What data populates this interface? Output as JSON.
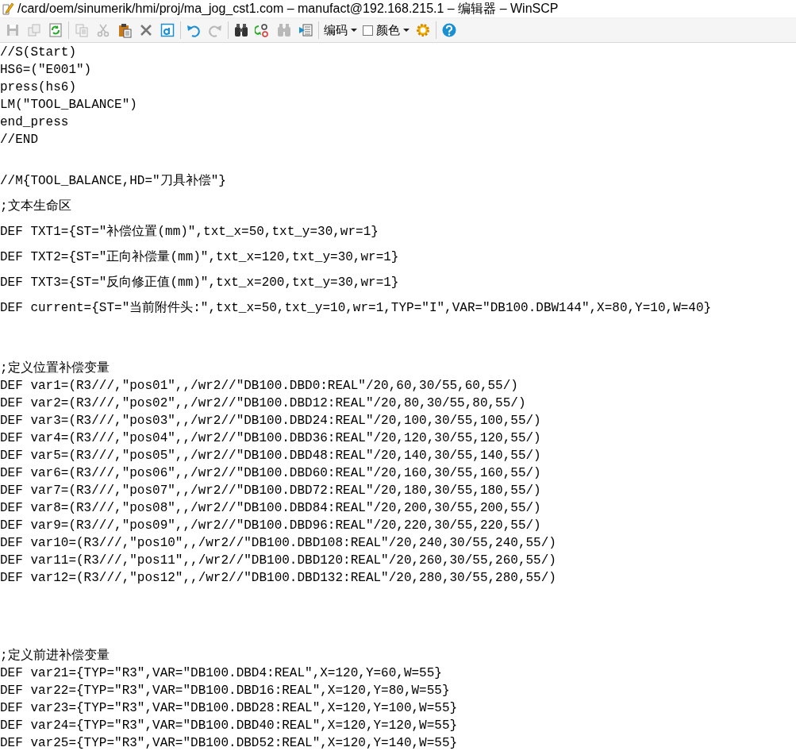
{
  "window": {
    "title": "/card/oem/sinumerik/hmi/proj/ma_jog_cst1.com – manufact@192.168.215.1 – 编辑器 – WinSCP"
  },
  "toolbar": {
    "groups": [
      [
        {
          "kind": "save",
          "disabled": true
        },
        {
          "kind": "copy-file",
          "disabled": true
        },
        {
          "kind": "refresh",
          "disabled": false
        }
      ],
      [
        {
          "kind": "copy",
          "disabled": true
        },
        {
          "kind": "cut",
          "disabled": true
        },
        {
          "kind": "paste",
          "disabled": false
        },
        {
          "kind": "delete",
          "disabled": false
        },
        {
          "kind": "select-all",
          "disabled": false
        }
      ],
      [
        {
          "kind": "undo",
          "disabled": false
        },
        {
          "kind": "redo",
          "disabled": true
        }
      ],
      [
        {
          "kind": "find",
          "disabled": false
        },
        {
          "kind": "replace",
          "disabled": false
        },
        {
          "kind": "find-next",
          "disabled": true
        },
        {
          "kind": "goto-line",
          "disabled": false
        }
      ],
      [
        {
          "kind": "menu",
          "label": "编码",
          "disabled": false
        },
        {
          "kind": "swatch-menu",
          "label": "颜色",
          "disabled": false
        },
        {
          "kind": "settings",
          "disabled": false
        }
      ],
      [
        {
          "kind": "help",
          "disabled": false
        }
      ]
    ]
  },
  "editor": {
    "blocks": [
      {
        "lines": [
          "//S(Start)",
          "HS6=(\"E001\")",
          "press(hs6)",
          "LM(\"TOOL_BALANCE\")",
          "end_press",
          "//END"
        ]
      },
      {
        "lines": [
          "//M{TOOL_BALANCE,HD=\"刀具补偿\"}",
          ";文本生命区",
          "DEF TXT1={ST=\"补偿位置(mm)\",txt_x=50,txt_y=30,wr=1}",
          "DEF TXT2={ST=\"正向补偿量(mm)\",txt_x=120,txt_y=30,wr=1}",
          "DEF TXT3={ST=\"反向修正值(mm)\",txt_x=200,txt_y=30,wr=1}",
          "DEF current={ST=\"当前附件头:\",txt_x=50,txt_y=10,wr=1,TYP=\"I\",VAR=\"DB100.DBW144\",X=80,Y=10,W=40}"
        ]
      },
      {
        "lines": [
          ";定义位置补偿变量",
          "DEF var1=(R3///,\"pos01\",,/wr2//\"DB100.DBD0:REAL\"/20,60,30/55,60,55/)",
          "DEF var2=(R3///,\"pos02\",,/wr2//\"DB100.DBD12:REAL\"/20,80,30/55,80,55/)",
          "DEF var3=(R3///,\"pos03\",,/wr2//\"DB100.DBD24:REAL\"/20,100,30/55,100,55/)",
          "DEF var4=(R3///,\"pos04\",,/wr2//\"DB100.DBD36:REAL\"/20,120,30/55,120,55/)",
          "DEF var5=(R3///,\"pos05\",,/wr2//\"DB100.DBD48:REAL\"/20,140,30/55,140,55/)",
          "DEF var6=(R3///,\"pos06\",,/wr2//\"DB100.DBD60:REAL\"/20,160,30/55,160,55/)",
          "DEF var7=(R3///,\"pos07\",,/wr2//\"DB100.DBD72:REAL\"/20,180,30/55,180,55/)",
          "DEF var8=(R3///,\"pos08\",,/wr2//\"DB100.DBD84:REAL\"/20,200,30/55,200,55/)",
          "DEF var9=(R3///,\"pos09\",,/wr2//\"DB100.DBD96:REAL\"/20,220,30/55,220,55/)",
          "DEF var10=(R3///,\"pos10\",,/wr2//\"DB100.DBD108:REAL\"/20,240,30/55,240,55/)",
          "DEF var11=(R3///,\"pos11\",,/wr2//\"DB100.DBD120:REAL\"/20,260,30/55,260,55/)",
          "DEF var12=(R3///,\"pos12\",,/wr2//\"DB100.DBD132:REAL\"/20,280,30/55,280,55/)"
        ]
      },
      {
        "lines": [
          ";定义前进补偿变量",
          "DEF var21={TYP=\"R3\",VAR=\"DB100.DBD4:REAL\",X=120,Y=60,W=55}",
          "DEF var22={TYP=\"R3\",VAR=\"DB100.DBD16:REAL\",X=120,Y=80,W=55}",
          "DEF var23={TYP=\"R3\",VAR=\"DB100.DBD28:REAL\",X=120,Y=100,W=55}",
          "DEF var24={TYP=\"R3\",VAR=\"DB100.DBD40:REAL\",X=120,Y=120,W=55}",
          "DEF var25={TYP=\"R3\",VAR=\"DB100.DBD52:REAL\",X=120,Y=140,W=55}"
        ]
      }
    ]
  }
}
